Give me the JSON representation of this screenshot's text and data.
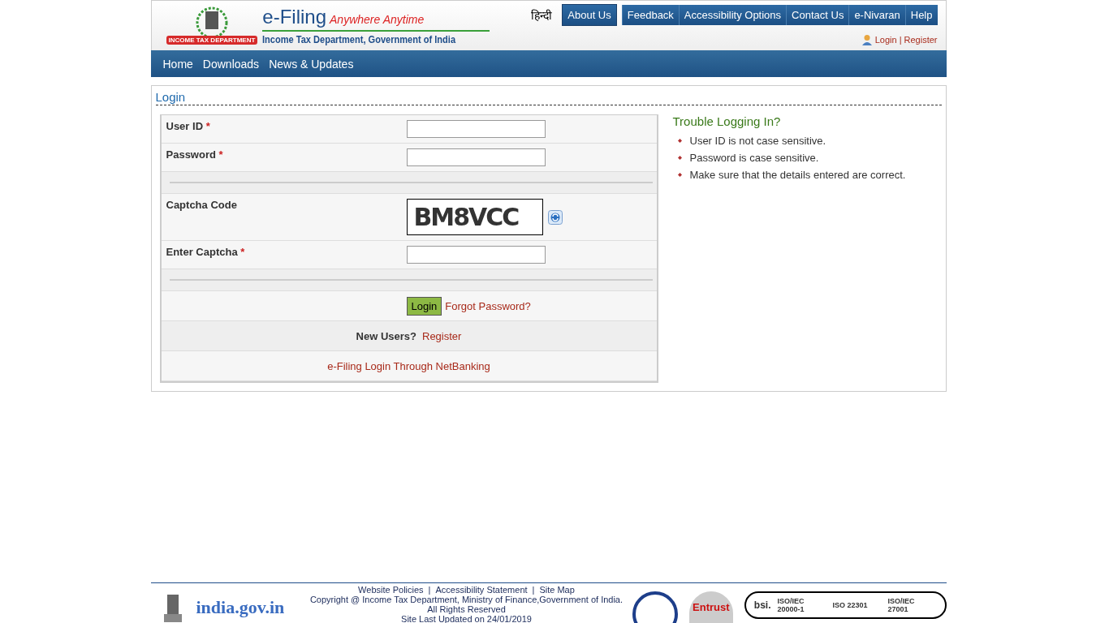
{
  "header": {
    "title": "e-Filing",
    "tagline": "Anywhere Anytime",
    "subtitle": "Income Tax Department, Government of India",
    "emblem_text": "INCOME TAX DEPARTMENT",
    "language_link": "हिन्दी",
    "top_menu": [
      "About Us",
      "Feedback",
      "Accessibility Options",
      "Contact Us",
      "e-Nivaran",
      "Help"
    ],
    "user_links": {
      "login": "Login",
      "separator": "|",
      "register": "Register"
    }
  },
  "nav": [
    "Home",
    "Downloads",
    "News & Updates"
  ],
  "login_panel": {
    "title": "Login",
    "rows": [
      {
        "kind": "input",
        "label": "User ID",
        "required_mark": "*"
      },
      {
        "kind": "input",
        "label": "Password",
        "required_mark": "*"
      },
      {
        "kind": "divider"
      },
      {
        "kind": "captcha",
        "label": "Captcha Code",
        "code": "BM8VCC"
      },
      {
        "kind": "input",
        "label": "Enter Captcha",
        "required_mark": "*"
      },
      {
        "kind": "divider"
      }
    ],
    "login_button": "Login",
    "forgot_link": "Forgot Password?",
    "new_users_label": "New Users?",
    "register_link": "Register",
    "netbanking_link": "e-Filing Login Through NetBanking"
  },
  "trouble": {
    "title": "Trouble Logging In?",
    "tips": [
      "User ID is not case sensitive.",
      "Password is case sensitive.",
      "Make sure that the details entered are correct."
    ]
  },
  "footer": {
    "links": [
      "Website Policies",
      "Accessibility Statement",
      "Site Map"
    ],
    "separator": "|",
    "copyright": "Copyright @ Income Tax Department, Ministry of Finance,Government of India.",
    "rights": "All Rights Reserved",
    "updated": "Site Last Updated on 24/01/2019",
    "portal": "india.gov.in",
    "badges": [
      "Entrust"
    ],
    "certs": [
      "ISO/IEC 20000-1",
      "ISO 22301",
      "ISO/IEC 27001"
    ],
    "bsi": "bsi."
  }
}
